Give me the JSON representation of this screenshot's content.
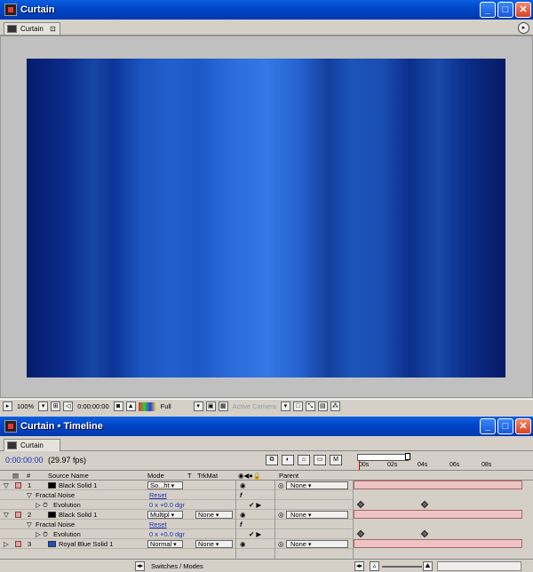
{
  "comp_window": {
    "title": "Curtain",
    "tab_label": "Curtain",
    "tab_close": "⊡"
  },
  "comp_viewer_bar": {
    "zoom": "100%",
    "timecode": "0:00:00:00",
    "resolution": "Full",
    "camera": "Active Camera"
  },
  "timeline_window": {
    "title": "Curtain • Timeline",
    "tab_label": "Curtain",
    "current_time": "0:00:00:00",
    "fps": "(29.97 fps)"
  },
  "columns": {
    "num": "#",
    "source_name": "Source Name",
    "mode": "Mode",
    "t": "T",
    "trkmat": "TrkMat",
    "parent": "Parent"
  },
  "ruler": {
    "ticks": [
      "00s",
      "02s",
      "04s",
      "06s",
      "08s"
    ]
  },
  "layers": [
    {
      "num": "1",
      "name": "Black Solid 1",
      "color": "#000000",
      "mode": "So...ht",
      "trkmat": "",
      "parent": "None"
    },
    {
      "num": "",
      "name": "Fractal Noise",
      "effect": true,
      "reset": "Reset"
    },
    {
      "num": "",
      "name": "Evolution",
      "prop": true,
      "value": "0 x +0.0 dgr"
    },
    {
      "num": "2",
      "name": "Black Solid 1",
      "color": "#000000",
      "mode": "Multipl",
      "trkmat": "None",
      "parent": "None"
    },
    {
      "num": "",
      "name": "Fractal Noise",
      "effect": true,
      "reset": "Reset"
    },
    {
      "num": "",
      "name": "Evolution",
      "prop": true,
      "value": "0 x +0.0 dgr"
    },
    {
      "num": "3",
      "name": "Royal Blue Solid 1",
      "color": "#1a4fc4",
      "mode": "Normal",
      "trkmat": "None",
      "parent": "None"
    }
  ],
  "bottom_bar": {
    "toggle": "Switches / Modes"
  },
  "colors": {
    "title_bar": "#0047c8",
    "layer_bar": "#eec3c3",
    "timecode": "#1a2fb0"
  }
}
